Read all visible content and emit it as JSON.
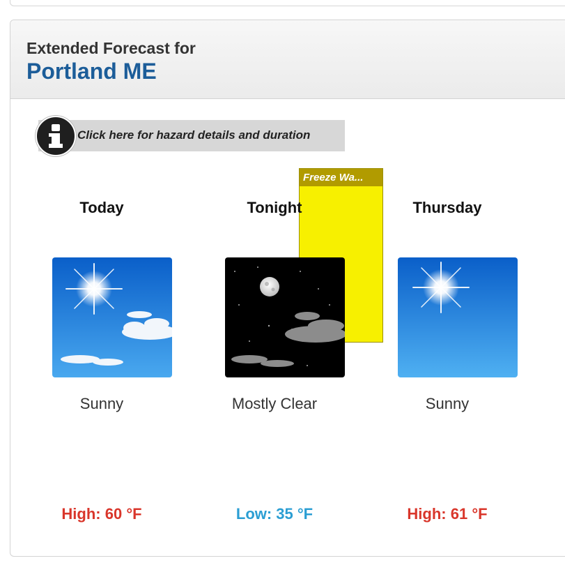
{
  "header": {
    "label": "Extended Forecast for",
    "location": "Portland ME"
  },
  "hazard": {
    "link_text": "Click here for hazard details and duration",
    "icon": "info-icon",
    "freeze_label": "Freeze Wa...",
    "freeze_color": "#f7f000"
  },
  "periods": [
    {
      "name": "Today",
      "icon": "sunny-icon",
      "desc": "Sunny",
      "temp": "High: 60 °F",
      "temp_color": "#d9362b"
    },
    {
      "name": "Tonight",
      "icon": "mostly-clear-night-icon",
      "desc": "Mostly Clear",
      "temp": "Low: 35 °F",
      "temp_color": "#2b9ed3"
    },
    {
      "name": "Thursday",
      "icon": "sunny-icon",
      "desc": "Sunny",
      "temp": "High: 61 °F",
      "temp_color": "#d9362b"
    }
  ]
}
